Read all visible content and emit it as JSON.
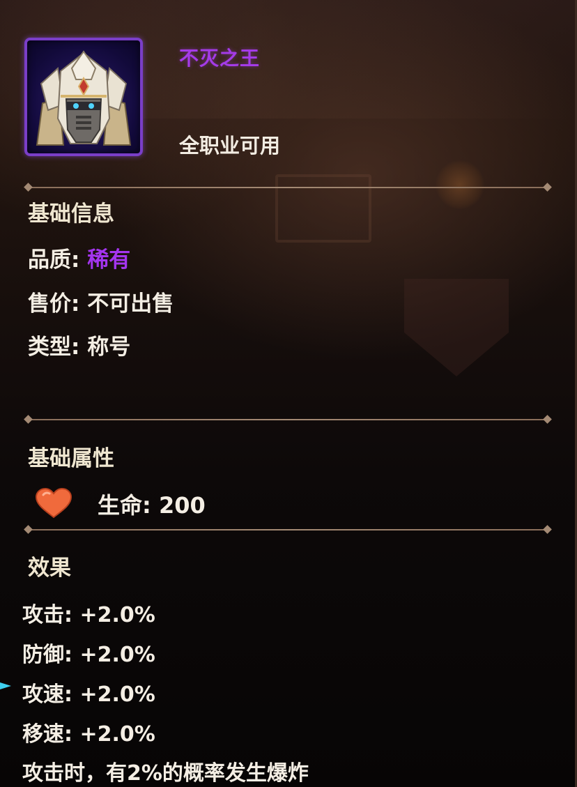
{
  "item": {
    "name": "不灭之王",
    "usable": "全职业可用",
    "name_color": "#a43be8"
  },
  "basic_info": {
    "title": "基础信息",
    "quality_label": "品质: ",
    "quality_value": "稀有",
    "quality_color": "#a435ef",
    "price_label": "售价: ",
    "price_value": "不可出售",
    "type_label": "类型: ",
    "type_value": "称号"
  },
  "basic_attributes": {
    "title": "基础属性",
    "life_label": "生命: ",
    "life_value": "200",
    "icon": "heart-icon"
  },
  "effects": {
    "title": "效果",
    "attack_label": "攻击: ",
    "attack_value": "+2.0%",
    "defense_label": "防御: ",
    "defense_value": "+2.0%",
    "attack_speed_label": "攻速: ",
    "attack_speed_value": "+2.0%",
    "move_speed_label": "移速: ",
    "move_speed_value": "+2.0%",
    "special": "攻击时，有2%的概率发生爆炸"
  }
}
